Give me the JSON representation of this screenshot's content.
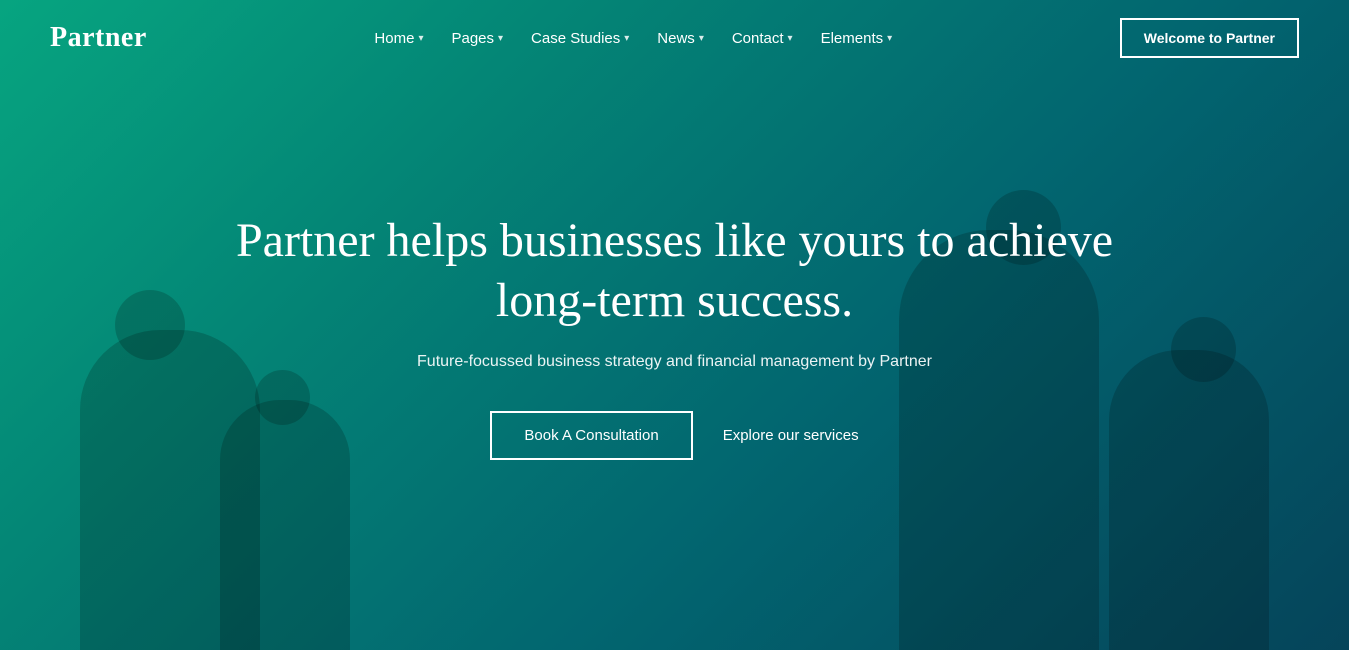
{
  "logo": {
    "text": "Partner"
  },
  "nav": {
    "links": [
      {
        "label": "Home",
        "has_dropdown": true
      },
      {
        "label": "Pages",
        "has_dropdown": true
      },
      {
        "label": "Case Studies",
        "has_dropdown": true
      },
      {
        "label": "News",
        "has_dropdown": true
      },
      {
        "label": "Contact",
        "has_dropdown": true
      },
      {
        "label": "Elements",
        "has_dropdown": true
      }
    ],
    "cta_label": "Welcome to Partner"
  },
  "hero": {
    "headline": "Partner helps businesses like yours to achieve long-term success.",
    "subheadline": "Future-focussed business strategy and financial management by Partner",
    "btn_consultation": "Book A Consultation",
    "btn_services": "Explore our services"
  }
}
